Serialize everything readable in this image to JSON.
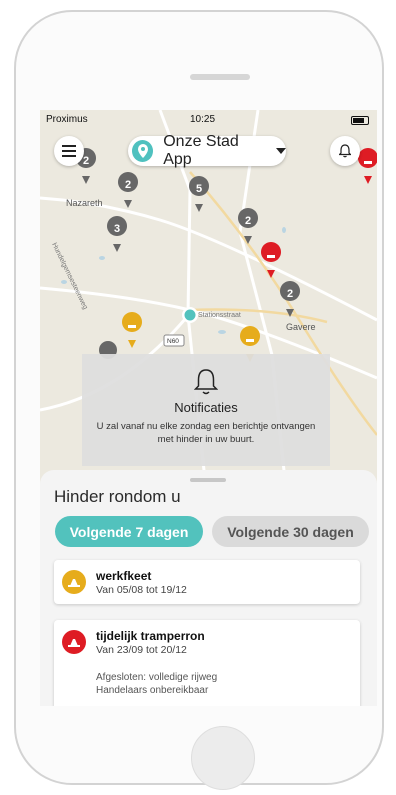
{
  "status_bar": {
    "carrier": "Proximus",
    "time": "10:25"
  },
  "header": {
    "app_name": "Onze Stad App"
  },
  "map": {
    "place_labels": {
      "nazareth": "Nazareth",
      "gavere": "Gavere",
      "street": "Stationsstraat",
      "road_shield": "N60",
      "vertical_road": "Hundelgemsesteenweg"
    },
    "cluster_counts": [
      "2",
      "2",
      "5",
      "3",
      "2",
      "2"
    ]
  },
  "notification": {
    "title": "Notificaties",
    "message": "U zal vanaf nu elke zondag een berichtje ontvangen met hinder in uw buurt."
  },
  "sheet": {
    "title": "Hinder rondom u",
    "tabs": [
      {
        "label": "Volgende 7 dagen"
      },
      {
        "label": "Volgende 30 dagen"
      }
    ],
    "items": [
      {
        "title": "werkfkeet",
        "dates": "Van 05/08 tot 19/12",
        "color": "#e6ac1c"
      },
      {
        "title": "tijdelijk tramperron",
        "dates": "Van 23/09 tot 20/12",
        "details": [
          "Afgesloten: volledige rijweg",
          "Handelaars onbereikbaar"
        ],
        "color": "#de1c24"
      }
    ]
  },
  "colors": {
    "accent": "#52c2bd",
    "warning": "#e6ac1c",
    "danger": "#de1c24",
    "cluster": "#676767"
  },
  "icons": {
    "menu": "hamburger-menu-icon",
    "location": "location-pin-icon",
    "bell": "bell-icon",
    "roadwork": "roadwork-icon"
  }
}
